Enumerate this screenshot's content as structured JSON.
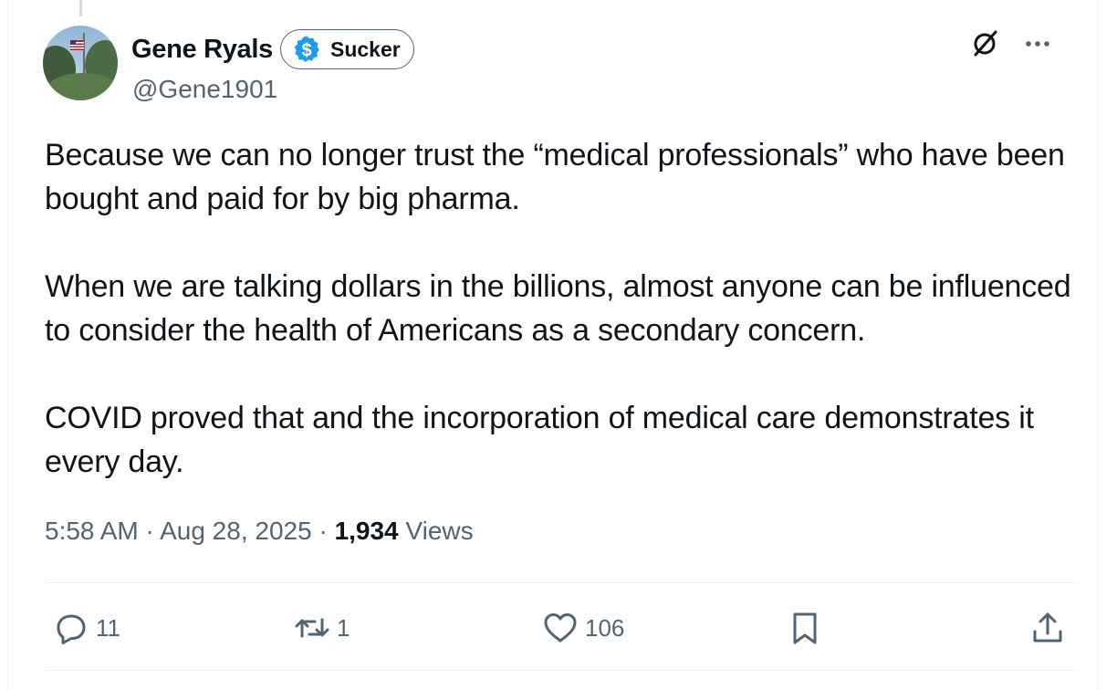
{
  "author": {
    "display_name": "Gene Ryals",
    "badge_label": "Sucker",
    "handle": "@Gene1901"
  },
  "top_icons": [
    "grok-icon",
    "more-icon"
  ],
  "tweet": {
    "paragraphs": [
      "Because we can no longer trust the “medical professionals” who have been bought and paid for by big pharma.",
      "When we are talking dollars in the billions, almost anyone can be influenced to consider the health of Americans as a secondary concern.",
      "COVID proved that and the incorporation of medical care demonstrates it every day."
    ]
  },
  "meta": {
    "time": "5:58 AM",
    "separator": " · ",
    "date": "Aug 28, 2025",
    "views_count": "1,934",
    "views_label": "Views"
  },
  "actions": {
    "reply_count": "11",
    "retweet_count": "1",
    "like_count": "106"
  },
  "colors": {
    "text_primary": "#0f1419",
    "text_secondary": "#536471",
    "badge_blue": "#1d9bf0",
    "divider": "#eff3f4"
  }
}
